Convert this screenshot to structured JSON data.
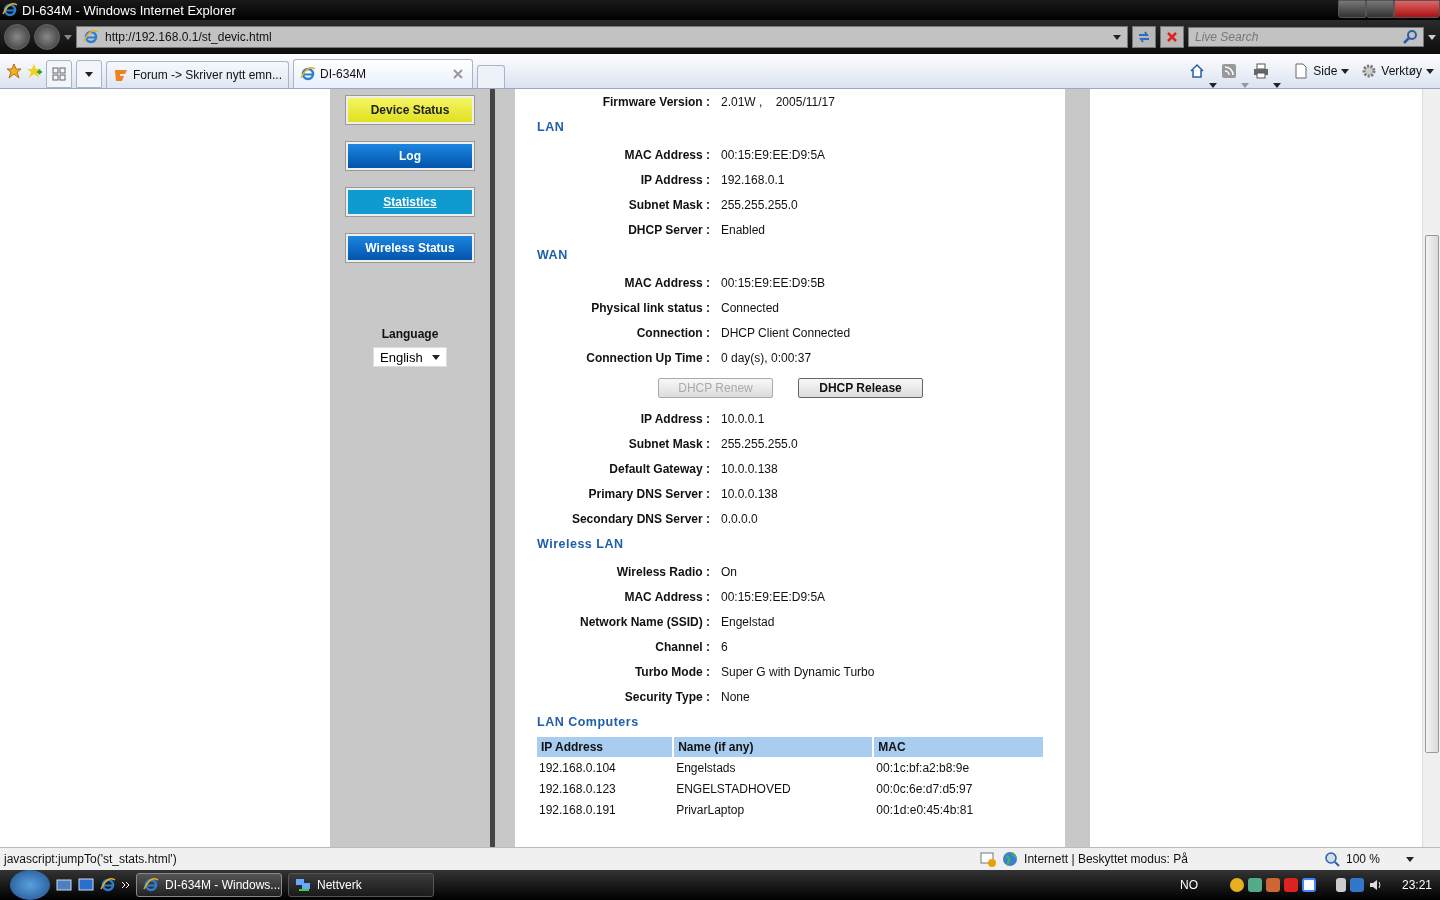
{
  "window": {
    "title": "DI-634M - Windows Internet Explorer"
  },
  "address_bar": {
    "url": "http://192.168.0.1/st_devic.html"
  },
  "search": {
    "placeholder": "Live Search"
  },
  "tabs": [
    {
      "label": "Forum -> Skriver nytt emn...",
      "selected": false
    },
    {
      "label": "DI-634M",
      "selected": true
    }
  ],
  "command_bar": [
    {
      "label": "Side"
    },
    {
      "label": "Verktøy"
    }
  ],
  "sidebar": {
    "menu": [
      {
        "label": "Device Status",
        "selected": true,
        "hovered": false
      },
      {
        "label": "Log",
        "selected": false,
        "hovered": false
      },
      {
        "label": "Statistics",
        "selected": false,
        "hovered": true
      },
      {
        "label": "Wireless Status",
        "selected": false,
        "hovered": false
      }
    ],
    "language_label": "Language",
    "language": {
      "value": "English"
    }
  },
  "sections": [
    {
      "items": [
        {
          "kind": "field",
          "label": "Firmware Version :",
          "value": "2.01W ,    2005/11/17"
        }
      ]
    },
    {
      "title": "LAN",
      "items": [
        {
          "kind": "field",
          "label": "MAC Address :",
          "value": "00:15:E9:EE:D9:5A"
        },
        {
          "kind": "field",
          "label": "IP Address :",
          "value": "192.168.0.1"
        },
        {
          "kind": "field",
          "label": "Subnet Mask :",
          "value": "255.255.255.0"
        },
        {
          "kind": "field",
          "label": "DHCP Server :",
          "value": "Enabled"
        }
      ]
    },
    {
      "title": "WAN",
      "items": [
        {
          "kind": "field",
          "label": "MAC Address :",
          "value": "00:15:E9:EE:D9:5B"
        },
        {
          "kind": "field",
          "label": "Physical link status :",
          "value": "Connected"
        },
        {
          "kind": "field",
          "label": "Connection :",
          "value": "DHCP Client Connected"
        },
        {
          "kind": "field",
          "label": "Connection Up Time :",
          "value": "0 day(s), 0:00:37"
        },
        {
          "kind": "buttons",
          "buttons": [
            {
              "label": "DHCP Renew",
              "disabled": true
            },
            {
              "label": "DHCP Release",
              "disabled": false
            }
          ]
        },
        {
          "kind": "field",
          "label": "IP Address :",
          "value": "10.0.0.1"
        },
        {
          "kind": "field",
          "label": "Subnet Mask :",
          "value": "255.255.255.0"
        },
        {
          "kind": "field",
          "label": "Default Gateway :",
          "value": "10.0.0.138"
        },
        {
          "kind": "field",
          "label": "Primary DNS Server :",
          "value": "10.0.0.138"
        },
        {
          "kind": "field",
          "label": "Secondary DNS Server :",
          "value": "0.0.0.0"
        }
      ]
    },
    {
      "title": "Wireless LAN",
      "items": [
        {
          "kind": "field",
          "label": "Wireless Radio :",
          "value": "On"
        },
        {
          "kind": "field",
          "label": "MAC Address :",
          "value": "00:15:E9:EE:D9:5A"
        },
        {
          "kind": "field",
          "label": "Network Name (SSID) :",
          "value": "Engelstad"
        },
        {
          "kind": "field",
          "label": "Channel :",
          "value": "6"
        },
        {
          "kind": "field",
          "label": "Turbo Mode :",
          "value": "Super G with Dynamic Turbo"
        },
        {
          "kind": "field",
          "label": "Security Type :",
          "value": "None"
        }
      ]
    },
    {
      "title": "LAN Computers",
      "items": [
        {
          "kind": "table",
          "columns": [
            "IP Address",
            "Name (if any)",
            "MAC"
          ],
          "rows": [
            [
              "192.168.0.104",
              "Engelstads",
              "00:1c:bf:a2:b8:9e"
            ],
            [
              "192.168.0.123",
              "ENGELSTADHOVED",
              "00:0c:6e:d7:d5:97"
            ],
            [
              "192.168.0.191",
              "PrivarLaptop",
              "00:1d:e0:45:4b:81"
            ]
          ]
        }
      ]
    }
  ],
  "status_bar": {
    "text": "javascript:jumpTo('st_stats.html')",
    "zone": "Internett | Beskyttet modus: På",
    "zoom": "100 %"
  },
  "taskbar": {
    "tasks": [
      {
        "label": "DI-634M - Windows...",
        "selected": true
      },
      {
        "label": "Nettverk",
        "selected": false
      }
    ],
    "language": "NO",
    "clock": "23:21"
  }
}
